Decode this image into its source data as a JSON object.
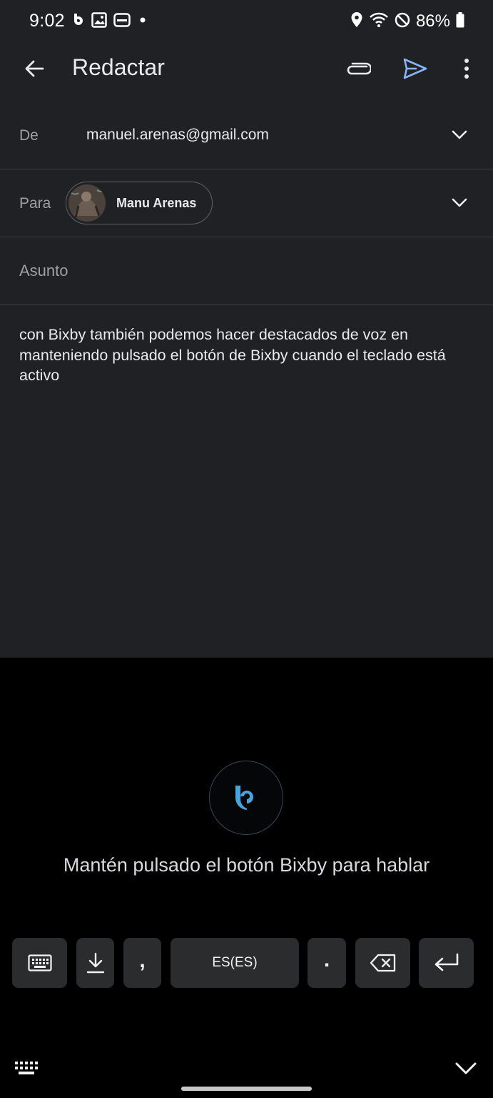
{
  "status_bar": {
    "time": "9:02",
    "battery": "86%"
  },
  "app_bar": {
    "title": "Redactar"
  },
  "compose": {
    "from_label": "De",
    "from_value": "manuel.arenas@gmail.com",
    "to_label": "Para",
    "recipient_name": "Manu Arenas",
    "subject_placeholder": "Asunto",
    "body": "con Bixby también podemos hacer destacados de voz en manteniendo pulsado el botón de Bixby cuando el teclado está activo"
  },
  "bixby": {
    "hint": "Mantén pulsado el botón Bixby para hablar",
    "accent_color": "#4ba3d9"
  },
  "keyboard": {
    "comma": ",",
    "language": "ES(ES)",
    "period": "."
  },
  "colors": {
    "compose_background": "#202124",
    "send_icon": "#8ab4f8"
  }
}
